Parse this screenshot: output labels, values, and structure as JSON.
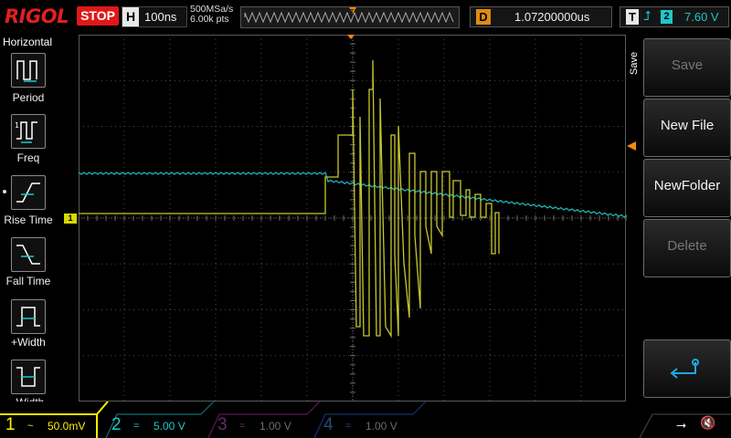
{
  "brand": {
    "logo": "RIGOL"
  },
  "status": {
    "run_state": "STOP"
  },
  "timebase": {
    "label": "H",
    "value": "100ns"
  },
  "sampling": {
    "rate": "500MSa/s",
    "points": "6.00k pts"
  },
  "delay": {
    "label": "D",
    "value": "1.07200000us"
  },
  "trigger": {
    "label": "T",
    "source": "2",
    "level": "7.60 V"
  },
  "left_menu": {
    "title": "Horizontal",
    "items": [
      {
        "label": "Period",
        "icon": "period-icon"
      },
      {
        "label": "Freq",
        "icon": "frequency-icon"
      },
      {
        "label": "Rise Time",
        "icon": "rise-time-icon"
      },
      {
        "label": "Fall Time",
        "icon": "fall-time-icon"
      },
      {
        "label": "+Width",
        "icon": "positive-width-icon"
      },
      {
        "label": "-Width",
        "icon": "negative-width-icon"
      }
    ]
  },
  "right_menu": {
    "title": "Save",
    "buttons": [
      {
        "label": "Save",
        "enabled": false
      },
      {
        "label": "New File",
        "enabled": true
      },
      {
        "label": "NewFolder",
        "enabled": true
      },
      {
        "label": "Delete",
        "enabled": false
      },
      {
        "label": "",
        "icon": "return-icon",
        "enabled": true
      }
    ]
  },
  "channels": [
    {
      "num": "1",
      "coupling": "~",
      "scale": "50.0mV",
      "color": "#ffee00",
      "active": true
    },
    {
      "num": "2",
      "coupling": "=",
      "scale": "5.00 V",
      "color": "#1ec8c8",
      "active": true
    },
    {
      "num": "3",
      "coupling": "=",
      "scale": "1.00 V",
      "color": "#d04ad0",
      "active": false
    },
    {
      "num": "4",
      "coupling": "=",
      "scale": "1.00 V",
      "color": "#2f7ad8",
      "active": false
    }
  ],
  "colors": {
    "ch1": "#c8c830",
    "ch2": "#1eb4b4",
    "trigger": "#f08a10",
    "grid": "#505050"
  },
  "system_icons": [
    "usb-icon",
    "speaker-muted-icon"
  ]
}
